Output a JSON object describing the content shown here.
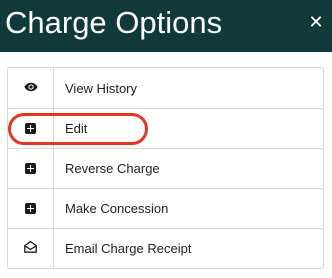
{
  "dialog": {
    "title": "Charge Options",
    "close_glyph": "✕"
  },
  "options": [
    {
      "label": "View History",
      "icon": "eye-icon"
    },
    {
      "label": "Edit",
      "icon": "plus-square-icon"
    },
    {
      "label": "Reverse Charge",
      "icon": "plus-square-icon"
    },
    {
      "label": "Make Concession",
      "icon": "plus-square-icon"
    },
    {
      "label": "Email Charge Receipt",
      "icon": "envelope-open-icon"
    }
  ],
  "colors": {
    "header_bg": "#12393a",
    "header_text": "#ffffff",
    "highlight": "#e8341f",
    "border": "#d9d9d9"
  }
}
